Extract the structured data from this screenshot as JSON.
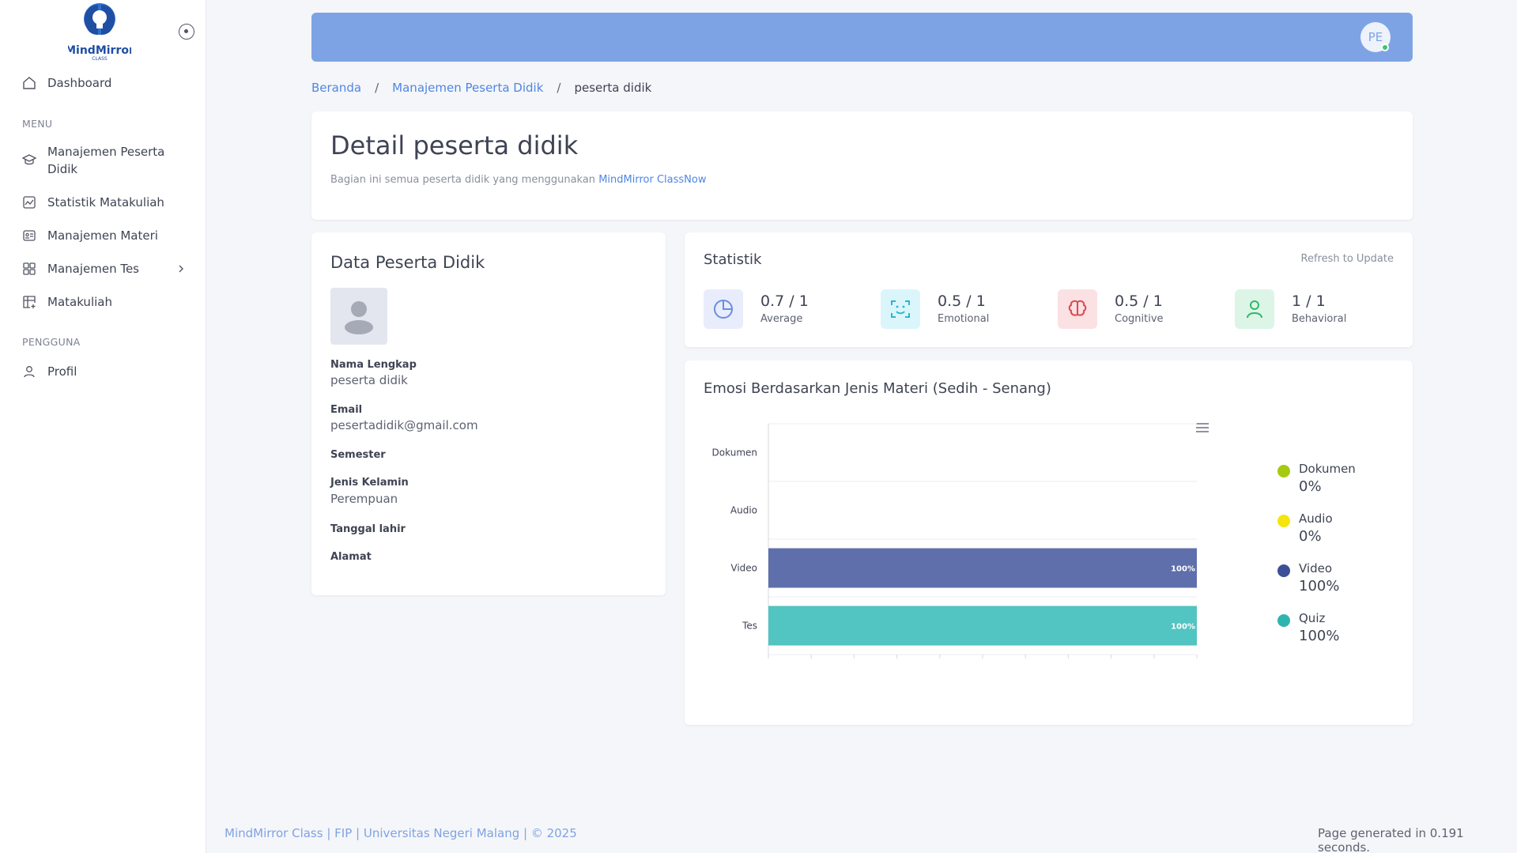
{
  "app": {
    "logo_text": "MindMirror",
    "logo_subtext": "CLASS"
  },
  "sidebar": {
    "dashboard": "Dashboard",
    "section_menu": "MENU",
    "items": [
      {
        "label": "Manajemen Peserta Didik"
      },
      {
        "label": "Statistik Matakuliah"
      },
      {
        "label": "Manajemen Materi"
      },
      {
        "label": "Manajemen Tes"
      },
      {
        "label": "Matakuliah"
      }
    ],
    "section_user": "PENGGUNA",
    "profile": "Profil"
  },
  "topbar": {
    "avatar_initials": "PE"
  },
  "breadcrumb": {
    "home": "Beranda",
    "parent": "Manajemen Peserta Didik",
    "current": "peserta didik",
    "separator": "/"
  },
  "header": {
    "title": "Detail peserta didik",
    "subtitle_prefix": "Bagian ini semua peserta didik yang menggunakan",
    "subtitle_link": "MindMirror ClassNow"
  },
  "profile_card": {
    "title": "Data Peserta Didik",
    "fields": {
      "name_label": "Nama Lengkap",
      "name_value": "peserta didik",
      "email_label": "Email",
      "email_value": "pesertadidik@gmail.com",
      "semester_label": "Semester",
      "gender_label": "Jenis Kelamin",
      "gender_value": "Perempuan",
      "dob_label": "Tanggal lahir",
      "address_label": "Alamat"
    }
  },
  "stats": {
    "title": "Statistik",
    "refresh": "Refresh to Update",
    "items": [
      {
        "value": "0.7 / 1",
        "label": "Average",
        "icon": "pie-chart-icon",
        "color": "#6b8de0",
        "bg": "#e8ecfb"
      },
      {
        "value": "0.5 / 1",
        "label": "Emotional",
        "icon": "face-scan-icon",
        "color": "#27b6d6",
        "bg": "#daf6fb"
      },
      {
        "value": "0.5 / 1",
        "label": "Cognitive",
        "icon": "brain-icon",
        "color": "#e0474f",
        "bg": "#fbe1e3"
      },
      {
        "value": "1 / 1",
        "label": "Behavioral",
        "icon": "user-icon",
        "color": "#2fb86a",
        "bg": "#dcf5e7"
      }
    ]
  },
  "chart_card": {
    "title": "Emosi Berdasarkan Jenis Materi (Sedih - Senang)",
    "side_legend": [
      {
        "name": "Dokumen",
        "value": "0%",
        "color": "#a6c912"
      },
      {
        "name": "Audio",
        "value": "0%",
        "color": "#f5e50d"
      },
      {
        "name": "Video",
        "value": "100%",
        "color": "#3c4f98"
      },
      {
        "name": "Quiz",
        "value": "100%",
        "color": "#2fb5b0"
      }
    ]
  },
  "chart_data": {
    "type": "bar",
    "orientation": "horizontal",
    "categories": [
      "Dokumen",
      "Audio",
      "Video",
      "Tes"
    ],
    "values": [
      0,
      0,
      100,
      100
    ],
    "data_labels": [
      "",
      "",
      "100%",
      "100%"
    ],
    "colors": [
      "#a6c912",
      "#f5e50d",
      "#5f6fab",
      "#52c4c2"
    ],
    "legend": [
      "Dokumen",
      "Audio",
      "Video",
      "Tes"
    ],
    "legend_colors": [
      "#a6c912",
      "#f5e50d",
      "#3c4f98",
      "#2fb5b0"
    ],
    "xlim": [
      0,
      100
    ],
    "xticks": [
      0,
      10,
      20,
      30,
      40,
      50,
      60,
      70,
      80,
      90,
      100
    ],
    "legend_position": "bottom"
  },
  "footer": {
    "left": "MindMirror Class | FIP | Universitas Negeri Malang | © 2025",
    "right": "Page generated in 0.191 seconds."
  }
}
